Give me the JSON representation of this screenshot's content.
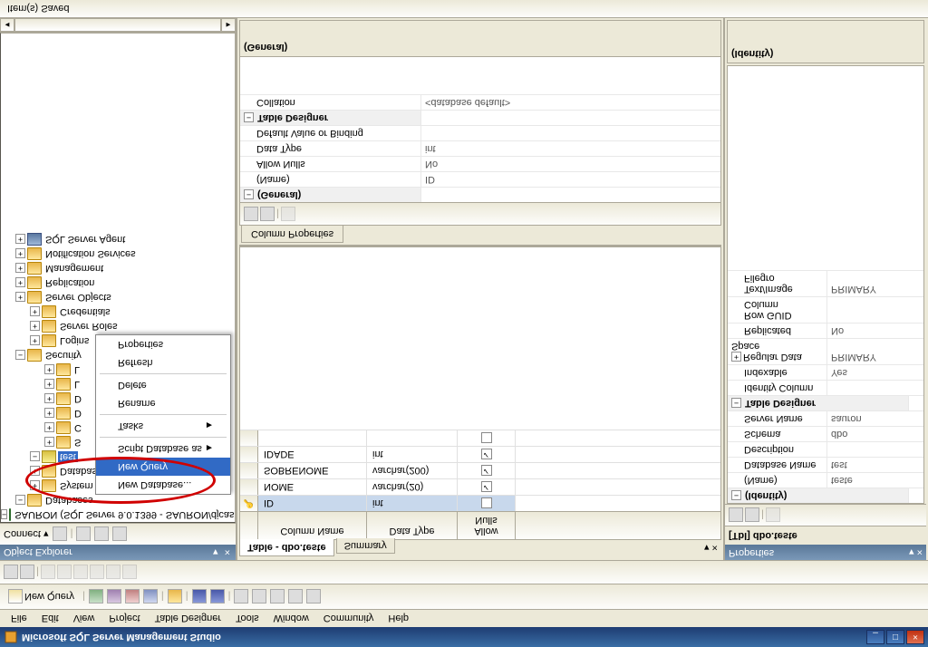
{
  "title": "Microsoft SQL Server Management Studio",
  "menu": [
    "File",
    "Edit",
    "View",
    "Project",
    "Table Designer",
    "Tools",
    "Window",
    "Community",
    "Help"
  ],
  "toolbar": {
    "newQuery": "New Query"
  },
  "objectExplorer": {
    "title": "Object Explorer",
    "connect": "Connect",
    "server": "SAURON (SQL Server 9.0.1399 - SAURON/djcass",
    "nodes": {
      "databases": "Databases",
      "systemDatabases": "System Databases",
      "databaseSnapshots": "Database Snapshots",
      "test": "test",
      "security": "Security",
      "logins": "Logins",
      "serverRoles": "Server Roles",
      "credentials": "Credentials",
      "serverObjects": "Server Objects",
      "replication": "Replication",
      "management": "Management",
      "notificationServices": "Notification Services",
      "sqlServerAgent": "SQL Server Agent"
    },
    "subItems": [
      "S",
      "C",
      "D",
      "D",
      "L",
      "L"
    ]
  },
  "contextMenu": {
    "newDatabase": "New Database...",
    "newQuery": "New Query",
    "scriptDatabase": "Script Database as",
    "tasks": "Tasks",
    "rename": "Rename",
    "delete": "Delete",
    "refresh": "Refresh",
    "properties": "Properties"
  },
  "tabs": {
    "table": "Table - dbo.teste",
    "summary": "Summary"
  },
  "grid": {
    "headers": {
      "name": "Column Name",
      "type": "Data Type",
      "nulls": "Allow Nulls"
    },
    "rows": [
      {
        "name": "ID",
        "type": "int",
        "null": false,
        "key": true
      },
      {
        "name": "NOME",
        "type": "varchar(20)",
        "null": true,
        "key": false
      },
      {
        "name": "SOBRENOME",
        "type": "varchar(200)",
        "null": true,
        "key": false
      },
      {
        "name": "IDADE",
        "type": "int",
        "null": true,
        "key": false
      }
    ]
  },
  "colProps": {
    "tab": "Column Properties",
    "general": "(General)",
    "rows": [
      {
        "label": "(Name)",
        "val": "ID"
      },
      {
        "label": "Allow Nulls",
        "val": "No"
      },
      {
        "label": "Data Type",
        "val": "int"
      },
      {
        "label": "Default Value or Binding",
        "val": ""
      }
    ],
    "tableDesigner": "Table Designer",
    "collation": {
      "label": "Collation",
      "val": "<database default>"
    },
    "footer": "(General)"
  },
  "properties": {
    "title": "Properties",
    "object": "[Tbl] dbo.teste",
    "identity": "(Identity)",
    "rows": [
      {
        "label": "(Name)",
        "val": "teste"
      },
      {
        "label": "Database Name",
        "val": "test"
      },
      {
        "label": "Description",
        "val": ""
      },
      {
        "label": "Schema",
        "val": "dbo"
      },
      {
        "label": "Server Name",
        "val": "sauron"
      }
    ],
    "tableDesigner": "Table Designer",
    "tdRows": [
      {
        "label": "Identity Column",
        "val": ""
      },
      {
        "label": "Indexable",
        "val": "Yes"
      },
      {
        "label": "Regular Data Space",
        "val": "PRIMARY",
        "expand": true
      },
      {
        "label": "Replicated",
        "val": "No"
      },
      {
        "label": "Row GUID Column",
        "val": ""
      },
      {
        "label": "Text/Image Filegro",
        "val": "PRIMARY"
      }
    ],
    "footer": "(Identity)"
  },
  "status": "Item(s) Saved"
}
